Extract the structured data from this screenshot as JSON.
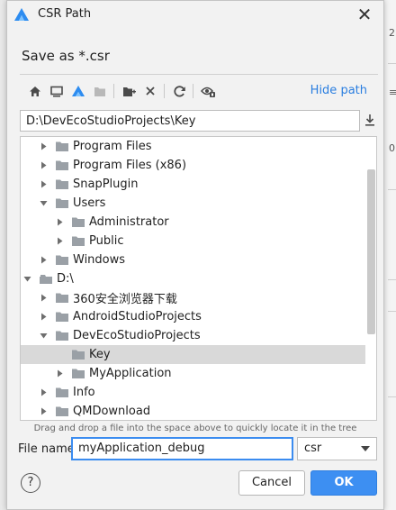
{
  "dialog": {
    "title": "CSR Path",
    "subtitle": "Save as *.csr"
  },
  "toolbar": {
    "buttons": [
      {
        "icon": "home-icon"
      },
      {
        "icon": "desktop-icon"
      },
      {
        "icon": "project-icon"
      },
      {
        "icon": "module-icon"
      },
      {
        "icon": "new-folder-icon"
      },
      {
        "icon": "delete-icon"
      },
      {
        "icon": "refresh-icon"
      },
      {
        "icon": "show-hidden-icon"
      }
    ],
    "hide_path": "Hide path"
  },
  "path_field": {
    "value": "D:\\DevEcoStudioProjects\\Key"
  },
  "tree": {
    "rows": [
      {
        "label": "Program Files",
        "expanded": false,
        "selected": false
      },
      {
        "label": "Program Files (x86)",
        "expanded": false,
        "selected": false
      },
      {
        "label": "SnapPlugin",
        "expanded": false,
        "selected": false
      },
      {
        "label": "Users",
        "expanded": true,
        "selected": false
      },
      {
        "label": "Administrator",
        "expanded": false,
        "selected": false
      },
      {
        "label": "Public",
        "expanded": false,
        "selected": false
      },
      {
        "label": "Windows",
        "expanded": false,
        "selected": false
      },
      {
        "label": "D:\\",
        "expanded": true,
        "selected": false
      },
      {
        "label": "360安全浏览器下载",
        "expanded": false,
        "selected": false
      },
      {
        "label": "AndroidStudioProjects",
        "expanded": false,
        "selected": false
      },
      {
        "label": "DevEcoStudioProjects",
        "expanded": true,
        "selected": false
      },
      {
        "label": "Key",
        "expanded": false,
        "selected": true
      },
      {
        "label": "MyApplication",
        "expanded": false,
        "selected": false
      },
      {
        "label": "Info",
        "expanded": false,
        "selected": false
      },
      {
        "label": "QMDownload",
        "expanded": false,
        "selected": false
      }
    ]
  },
  "hint": "Drag and drop a file into the space above to quickly locate it in the tree",
  "file_name": {
    "label": "File name:",
    "value": "myApplication_debug"
  },
  "extension": {
    "selected": "csr"
  },
  "buttons": {
    "help": "?",
    "cancel": "Cancel",
    "ok": "OK"
  },
  "colors": {
    "accent": "#3d8ff2",
    "link": "#2a7ee0",
    "folder": "#9aa0a6",
    "selection": "#d9d9d9"
  },
  "background_window": {
    "fragments": [
      "2",
      "≡",
      "0"
    ]
  }
}
